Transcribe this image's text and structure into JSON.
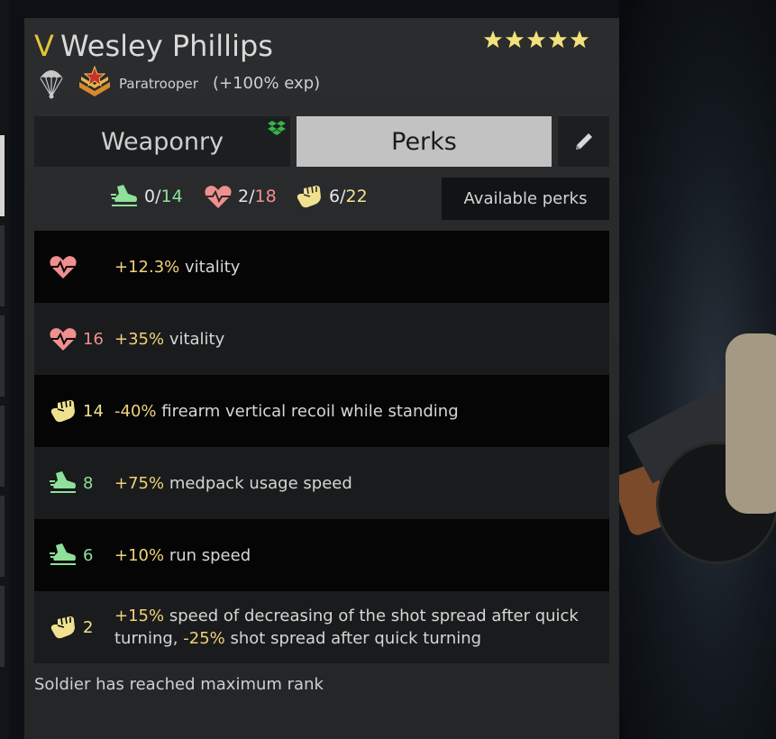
{
  "soldier": {
    "rank_glyph": "V",
    "name": "Wesley Phillips",
    "stars": 5,
    "class_name": "Paratrooper",
    "class_bonus": "(+100% exp)"
  },
  "tabs": [
    {
      "label": "Weaponry",
      "active": false
    },
    {
      "label": "Perks",
      "active": true
    }
  ],
  "points": {
    "speed": {
      "current": "0",
      "max": "14",
      "color": "#8fe09a"
    },
    "vitality": {
      "current": "2",
      "max": "18",
      "color": "#f08f8f"
    },
    "strength": {
      "current": "6",
      "max": "22",
      "color": "#f0e190"
    }
  },
  "available_perks_label": "Available perks",
  "perks": [
    {
      "icon": "heart-pulse-icon",
      "level": "",
      "parts": [
        {
          "v": "+12.3%"
        },
        {
          "t": " vitality"
        }
      ]
    },
    {
      "icon": "heart-pulse-icon",
      "level": "16",
      "parts": [
        {
          "v": "+35%"
        },
        {
          "t": " vitality"
        }
      ]
    },
    {
      "icon": "fist-icon",
      "level": "14",
      "parts": [
        {
          "v": "-40%"
        },
        {
          "t": " firearm vertical recoil while standing"
        }
      ]
    },
    {
      "icon": "running-shoe-icon",
      "level": "8",
      "parts": [
        {
          "v": "+75%"
        },
        {
          "t": " medpack usage speed"
        }
      ]
    },
    {
      "icon": "running-shoe-icon",
      "level": "6",
      "parts": [
        {
          "v": "+10%"
        },
        {
          "t": " run speed"
        }
      ]
    },
    {
      "icon": "fist-icon",
      "level": "2",
      "parts": [
        {
          "v": "+15%"
        },
        {
          "t": " speed of decreasing of the shot spread after quick turning, "
        },
        {
          "v": "-25%"
        },
        {
          "t": " shot spread after quick turning"
        }
      ]
    }
  ],
  "footer_message": "Soldier has reached maximum rank",
  "colors": {
    "accent_gold": "#e3c537",
    "value_yellow": "#f0d278",
    "heart_red": "#f08f8f",
    "shoe_green": "#8fe09a",
    "fist_yellow": "#f0e190"
  }
}
